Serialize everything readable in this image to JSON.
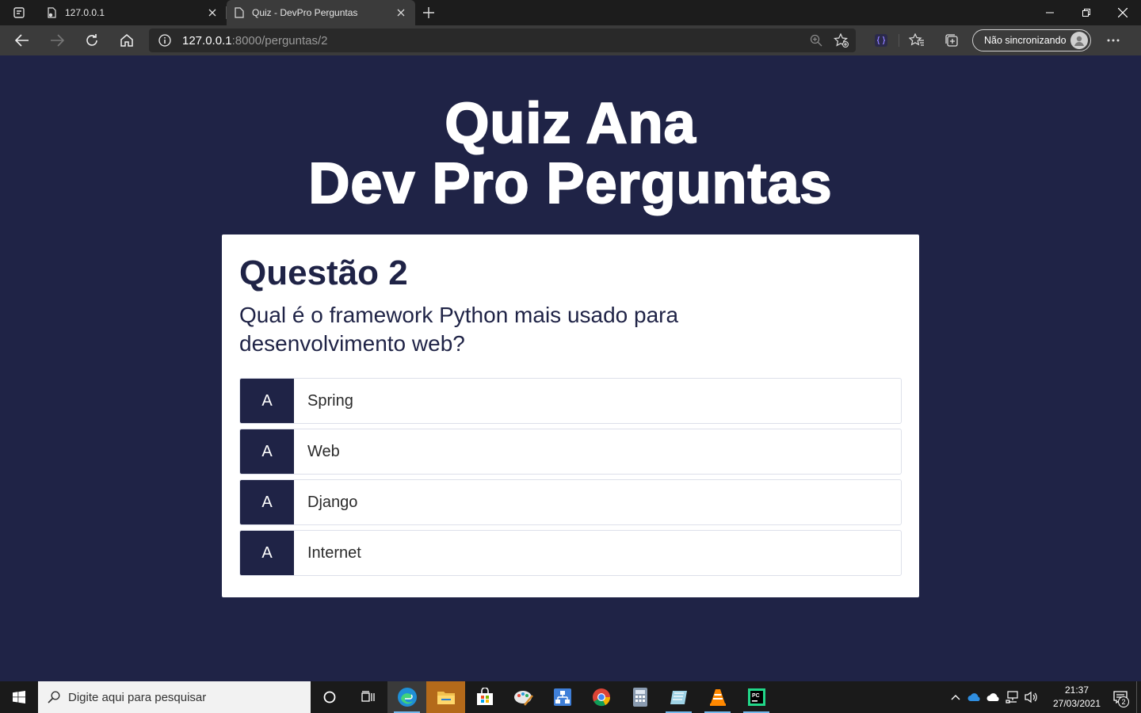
{
  "browser": {
    "tabs": [
      {
        "title": "127.0.0.1",
        "active": false
      },
      {
        "title": "Quiz - DevPro Perguntas",
        "active": true
      }
    ],
    "url_host": "127.0.0.1",
    "url_rest": ":8000/perguntas/2",
    "sync_label": "Não sincronizando"
  },
  "page": {
    "title_line1": "Quiz Ana",
    "title_line2": "Dev Pro Perguntas",
    "question_heading": "Questão 2",
    "question_text": "Qual é o framework Python mais usado para desenvolvimento web?",
    "answers": [
      {
        "letter": "A",
        "text": "Spring"
      },
      {
        "letter": "A",
        "text": "Web"
      },
      {
        "letter": "A",
        "text": "Django"
      },
      {
        "letter": "A",
        "text": "Internet"
      }
    ]
  },
  "taskbar": {
    "search_placeholder": "Digite aqui para pesquisar",
    "time": "21:37",
    "date": "27/03/2021",
    "notification_count": "2"
  },
  "colors": {
    "page_background": "#1f2346",
    "card_background": "#ffffff",
    "answer_letter_background": "#1f2346"
  }
}
